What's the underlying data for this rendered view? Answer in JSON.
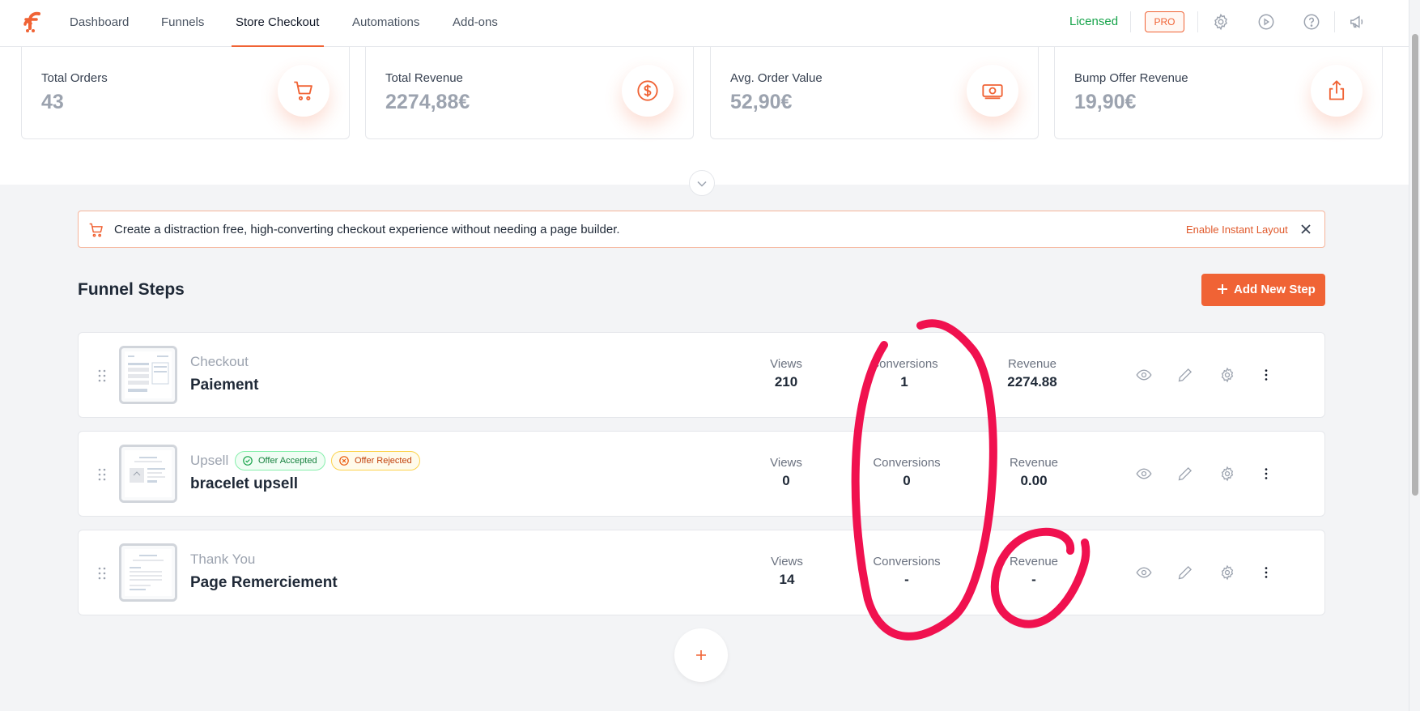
{
  "nav": {
    "tabs": [
      {
        "label": "Dashboard"
      },
      {
        "label": "Funnels"
      },
      {
        "label": "Store Checkout"
      },
      {
        "label": "Automations"
      },
      {
        "label": "Add-ons"
      }
    ],
    "active_tab": "Store Checkout",
    "licensed_label": "Licensed",
    "pro_label": "PRO",
    "icons": [
      "gear-icon",
      "play-icon",
      "help-icon",
      "megaphone-icon"
    ]
  },
  "stats": [
    {
      "label": "Total Orders",
      "value": "43",
      "icon": "cart-icon"
    },
    {
      "label": "Total Revenue",
      "value": "2274,88€",
      "icon": "dollar-circle-icon"
    },
    {
      "label": "Avg. Order Value",
      "value": "52,90€",
      "icon": "money-bill-icon"
    },
    {
      "label": "Bump Offer Revenue",
      "value": "19,90€",
      "icon": "share-upload-icon"
    }
  ],
  "notice": {
    "text": "Create a distraction free, high-converting checkout experience without needing a page builder.",
    "link": "Enable Instant Layout"
  },
  "funnel": {
    "title": "Funnel Steps",
    "add_button": "Add New Step",
    "steps": [
      {
        "type": "Checkout",
        "name": "Paiement",
        "views_label": "Views",
        "views": "210",
        "conversions_label": "Conversions",
        "conversions": "1",
        "revenue_label": "Revenue",
        "revenue": "2274.88"
      },
      {
        "type": "Upsell",
        "name": "bracelet upsell",
        "badge_accepted": "Offer Accepted",
        "badge_rejected": "Offer Rejected",
        "views_label": "Views",
        "views": "0",
        "conversions_label": "Conversions",
        "conversions": "0",
        "revenue_label": "Revenue",
        "revenue": "0.00"
      },
      {
        "type": "Thank You",
        "name": "Page Remerciement",
        "views_label": "Views",
        "views": "14",
        "conversions_label": "Conversions",
        "conversions": "-",
        "revenue_label": "Revenue",
        "revenue": "-"
      }
    ]
  },
  "colors": {
    "accent": "#f06335",
    "licensed": "#16a34a",
    "annotation": "#f0114f"
  }
}
